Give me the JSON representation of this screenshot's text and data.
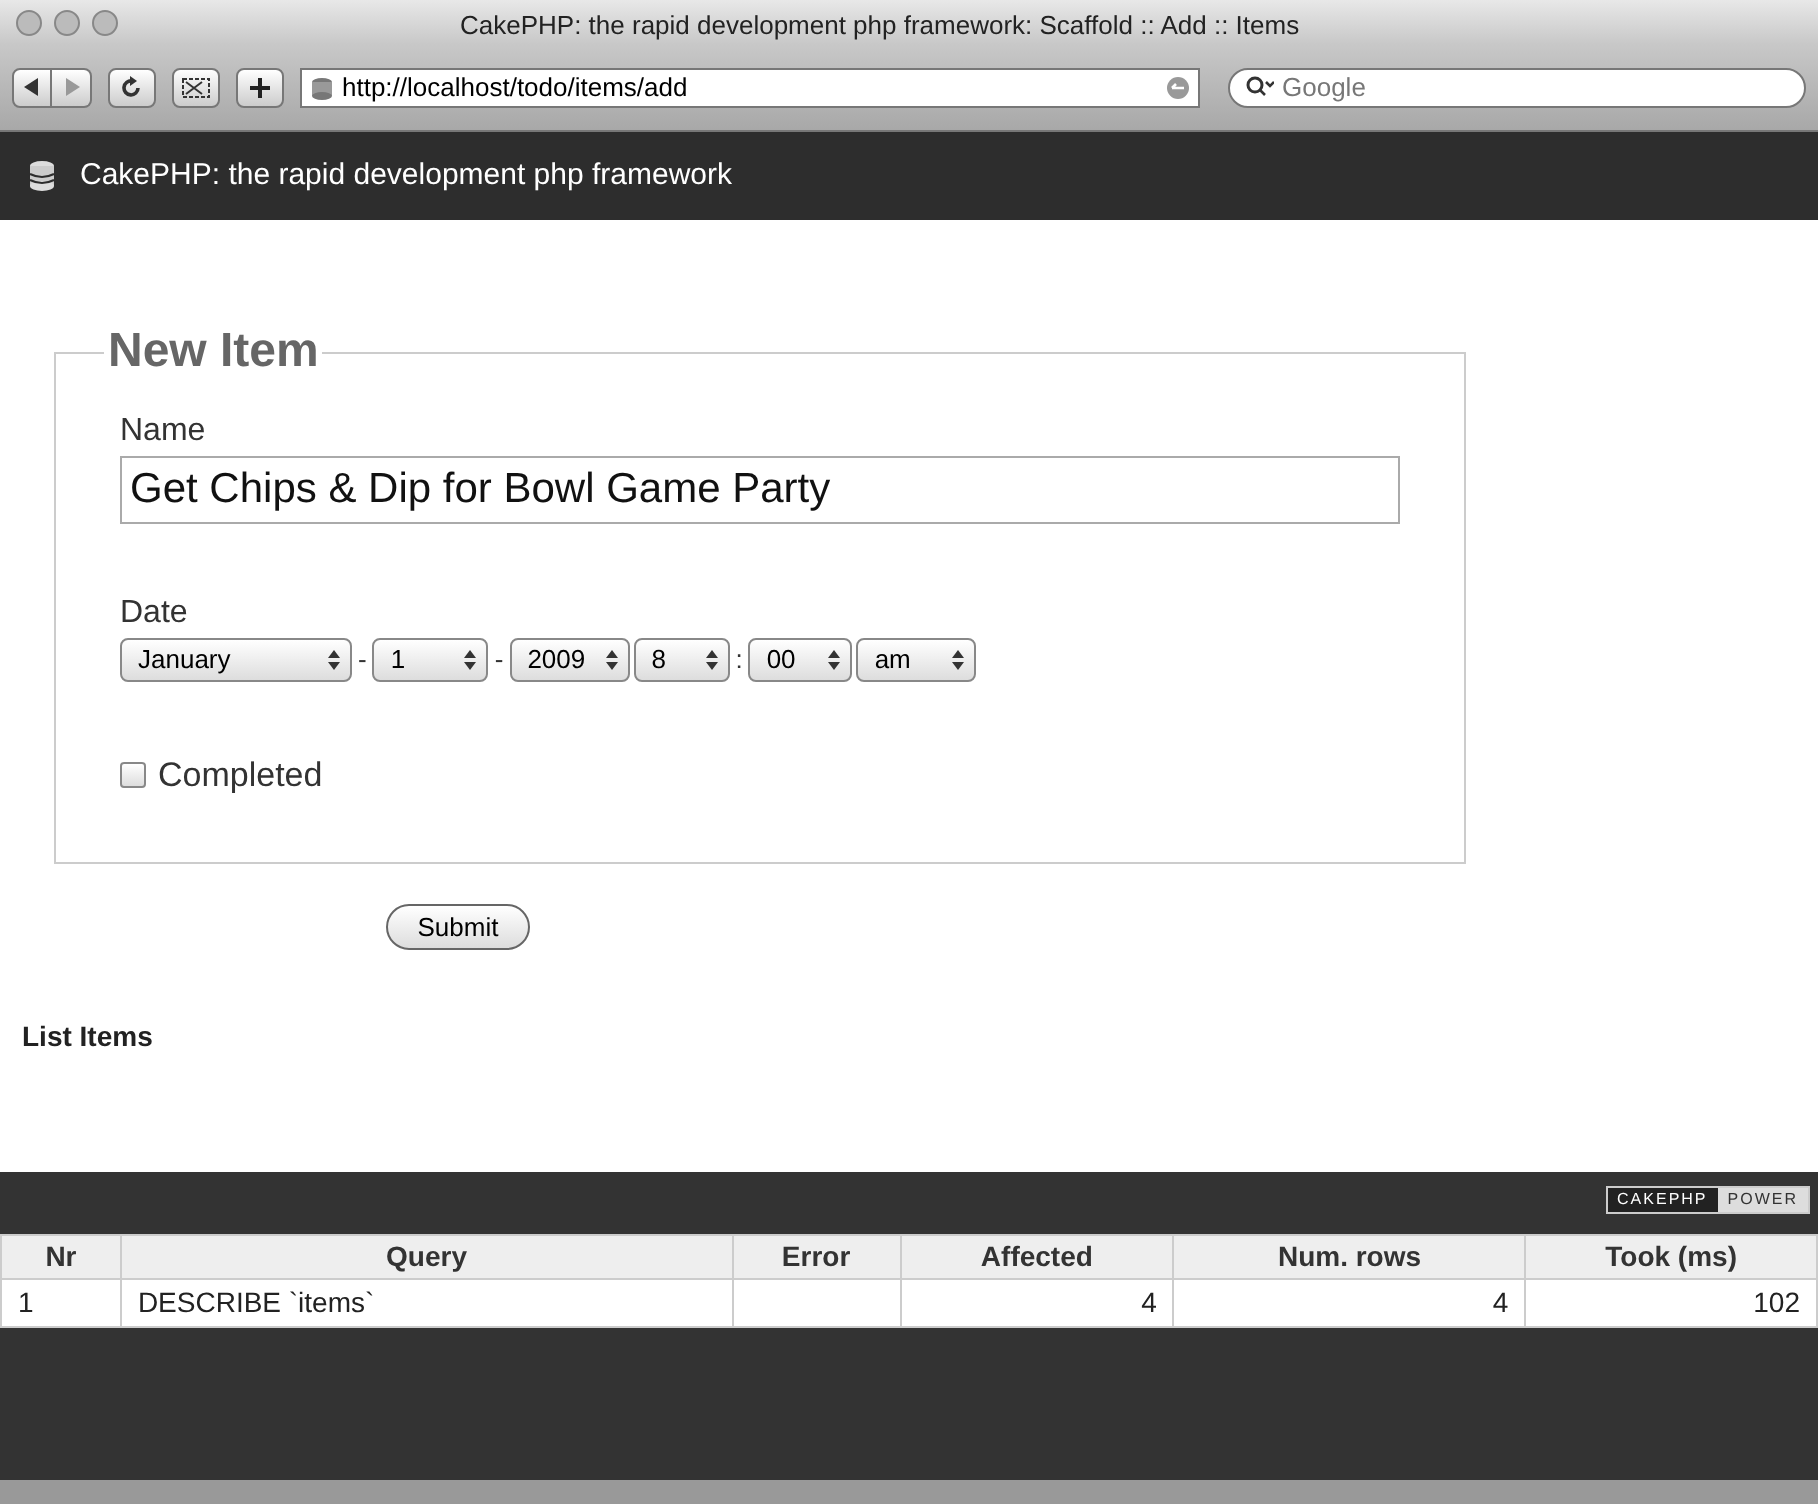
{
  "window": {
    "title": "CakePHP: the rapid development php framework: Scaffold :: Add :: Items"
  },
  "toolbar": {
    "url": "http://localhost/todo/items/add",
    "search": {
      "placeholder": "Google"
    }
  },
  "header": {
    "title": "CakePHP: the rapid development php framework"
  },
  "form": {
    "legend": "New Item",
    "name": {
      "label": "Name",
      "value": "Get Chips & Dip for Bowl Game Party"
    },
    "date": {
      "label": "Date",
      "parts": [
        {
          "kind": "select",
          "value": "January"
        },
        {
          "kind": "separator",
          "text": "-"
        },
        {
          "kind": "select",
          "value": "1"
        },
        {
          "kind": "separator",
          "text": "-"
        },
        {
          "kind": "select",
          "value": "2009"
        },
        {
          "kind": "select",
          "value": "8"
        },
        {
          "kind": "separator",
          "text": ":"
        },
        {
          "kind": "select",
          "value": "00"
        },
        {
          "kind": "select",
          "value": "am"
        }
      ]
    },
    "completed": {
      "label": "Completed",
      "checked": false
    },
    "submit": "Submit"
  },
  "list_link": "List Items",
  "footer": {
    "badge": [
      "CAKEPHP",
      "POWER"
    ]
  },
  "table": {
    "columns": [
      "Nr",
      "Query",
      "Error",
      "Affected",
      "Num. rows",
      "Took (ms)"
    ],
    "rows": [
      [
        "1",
        "DESCRIBE `items`",
        "",
        "4",
        "4",
        "102"
      ]
    ]
  }
}
